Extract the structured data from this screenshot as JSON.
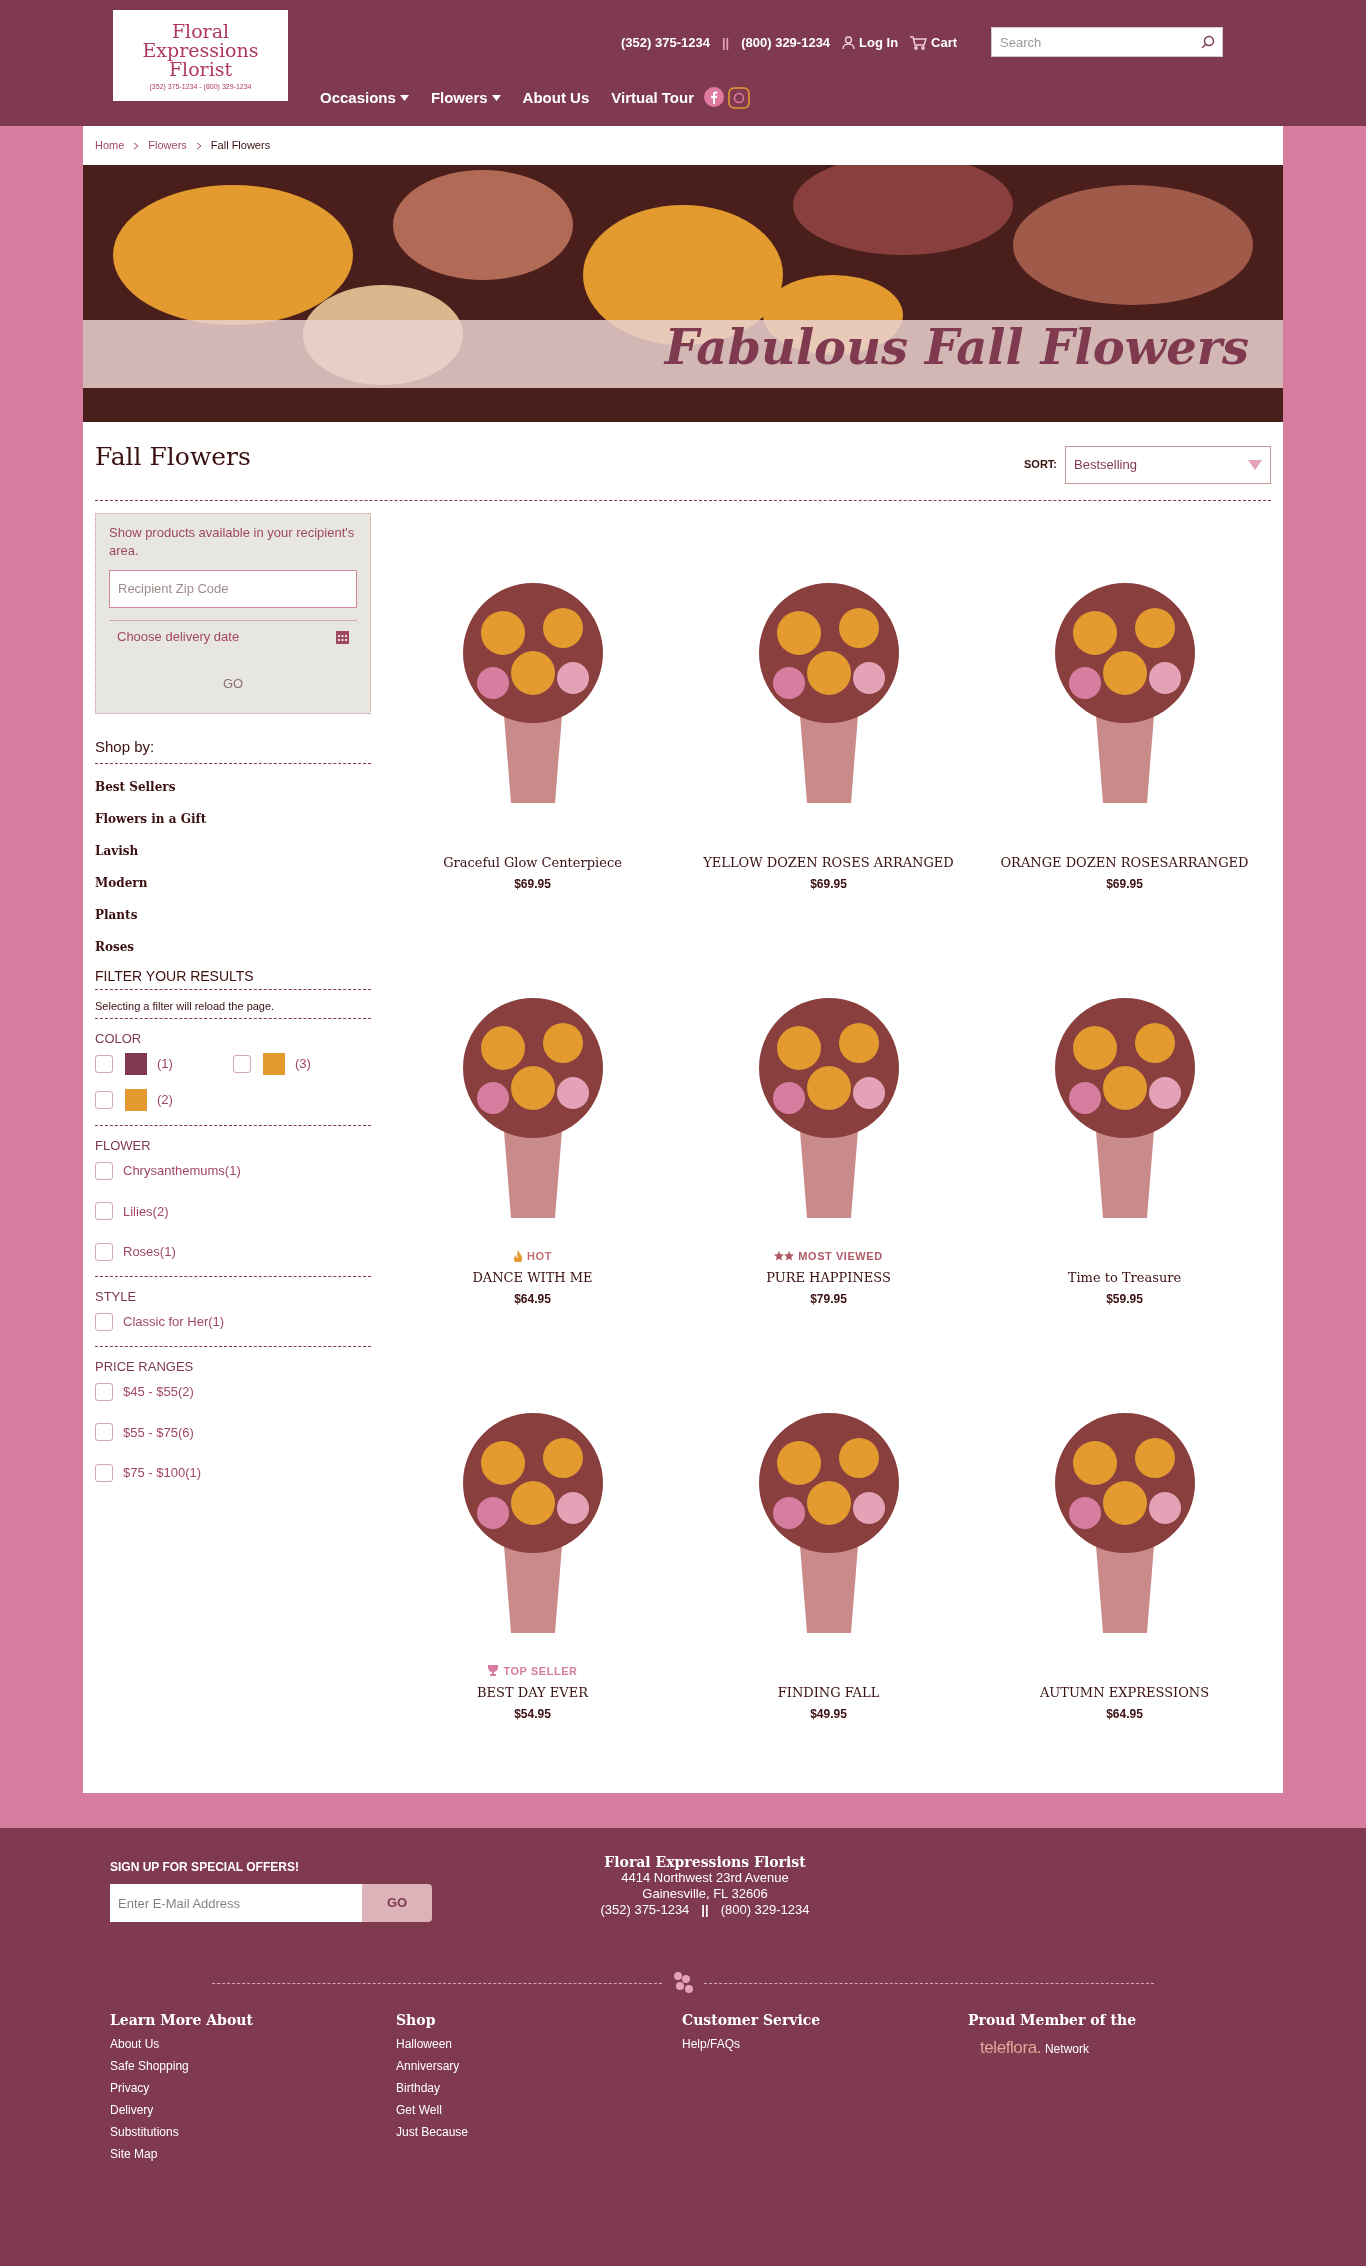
{
  "header": {
    "logo": {
      "line1": "Floral",
      "line2": "Expressions",
      "line3": "Florist",
      "phones": "(352) 375-1234 - (800) 329-1234"
    },
    "phone1": "(352) 375-1234",
    "separator": "||",
    "phone2": "(800) 329-1234",
    "login": "Log In",
    "cart": "Cart",
    "search": {
      "placeholder": "Search"
    },
    "nav": [
      {
        "label": "Occasions",
        "dropdown": true
      },
      {
        "label": "Flowers",
        "dropdown": true
      },
      {
        "label": "About Us",
        "dropdown": false
      },
      {
        "label": "Virtual Tour",
        "dropdown": false
      }
    ]
  },
  "breadcrumb": [
    {
      "label": "Home",
      "current": false
    },
    {
      "label": "Flowers",
      "current": false
    },
    {
      "label": "Fall Flowers",
      "current": true
    }
  ],
  "banner": {
    "title": "Fabulous Fall Flowers"
  },
  "page_title": "Fall Flowers",
  "sort": {
    "label": "SORT:",
    "value": "Bestselling"
  },
  "delivery": {
    "note": "Show products available in your recipient's area.",
    "zip_placeholder": "Recipient Zip Code",
    "date_placeholder": "Choose delivery date",
    "go": "GO"
  },
  "shop_by": {
    "title": "Shop by:",
    "items": [
      "Best Sellers",
      "Flowers in a Gift",
      "Lavish",
      "Modern",
      "Plants",
      "Roses"
    ]
  },
  "filters": {
    "title": "FILTER YOUR RESULTS",
    "note": "Selecting a filter will reload the page.",
    "groups": [
      {
        "title": "COLOR",
        "kind": "color",
        "options": [
          {
            "count": "(1)",
            "color": "#7f3a50",
            "checked": false
          },
          {
            "count": "(3)",
            "color": "#e39a2e",
            "checked": false
          },
          {
            "count": "(2)",
            "color": "#e39a2e",
            "checked": false
          }
        ]
      },
      {
        "title": "FLOWER",
        "kind": "text",
        "options": [
          {
            "label": "Chrysanthemums(1)",
            "checked": false
          },
          {
            "label": "Lilies(2)",
            "checked": false
          },
          {
            "label": "Roses(1)",
            "checked": false
          }
        ]
      },
      {
        "title": "STYLE",
        "kind": "text",
        "options": [
          {
            "label": "Classic for Her(1)",
            "checked": false
          }
        ]
      },
      {
        "title": "PRICE RANGES",
        "kind": "text",
        "options": [
          {
            "label": "$45 - $55(2)",
            "checked": false
          },
          {
            "label": "$55 - $75(6)",
            "checked": false
          },
          {
            "label": "$75 - $100(1)",
            "checked": false
          }
        ]
      }
    ]
  },
  "products": [
    {
      "name": "Graceful Glow Centerpiece",
      "price": "$69.95"
    },
    {
      "name": "YELLOW DOZEN ROSES ARRANGED",
      "price": "$69.95"
    },
    {
      "name": "ORANGE DOZEN ROSESARRANGED",
      "price": "$69.95"
    },
    {
      "name": "DANCE WITH ME",
      "price": "$64.95",
      "badge": {
        "kind": "hot",
        "label": "HOT"
      }
    },
    {
      "name": "PURE HAPPINESS",
      "price": "$79.95",
      "badge": {
        "kind": "viewed",
        "label": "MOST VIEWED"
      }
    },
    {
      "name": "Time to Treasure",
      "price": "$59.95"
    },
    {
      "name": "BEST DAY EVER",
      "price": "$54.95",
      "badge": {
        "kind": "top",
        "label": "TOP SELLER"
      }
    },
    {
      "name": "FINDING FALL",
      "price": "$49.95"
    },
    {
      "name": "AUTUMN EXPRESSIONS",
      "price": "$64.95"
    }
  ],
  "footer": {
    "signup_title": "SIGN UP FOR SPECIAL OFFERS!",
    "email_placeholder": "Enter E-Mail Address",
    "go": "GO",
    "store": {
      "name": "Floral Expressions Florist",
      "street": "4414 Northwest 23rd Avenue",
      "city": "Gainesville, FL  32606",
      "phone1": "(352) 375-1234",
      "separator": "||",
      "phone2": "(800) 329-1234"
    },
    "columns": [
      {
        "title": "Learn More About",
        "links": [
          "About Us",
          "Safe Shopping",
          "Privacy",
          "Delivery",
          "Substitutions",
          "Site Map"
        ]
      },
      {
        "title": "Shop",
        "links": [
          "Halloween",
          "Anniversary",
          "Birthday",
          "Get Well",
          "Just Because"
        ]
      },
      {
        "title": "Customer Service",
        "links": [
          "Help/FAQs"
        ]
      },
      {
        "title": "Proud Member of the",
        "brand": "teleflora.",
        "brand_suffix": "Network"
      }
    ]
  }
}
